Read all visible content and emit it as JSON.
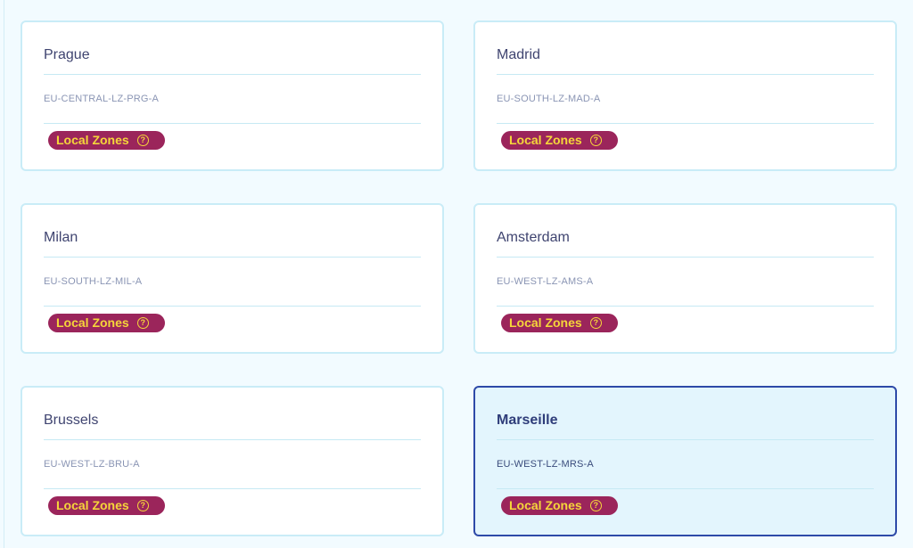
{
  "badge": {
    "label": "Local Zones",
    "icon": "question-circle-icon",
    "icon_glyph": "?",
    "bg_color": "#9b255b",
    "text_color": "#f5d63a"
  },
  "colors": {
    "selected_border": "#2e4aa8",
    "selected_bg": "#e3f5fd",
    "card_border": "#c9ecf7"
  },
  "zones": [
    {
      "name": "Prague",
      "code": "EU-CENTRAL-LZ-PRG-A",
      "selected": false
    },
    {
      "name": "Madrid",
      "code": "EU-SOUTH-LZ-MAD-A",
      "selected": false
    },
    {
      "name": "Milan",
      "code": "EU-SOUTH-LZ-MIL-A",
      "selected": false
    },
    {
      "name": "Amsterdam",
      "code": "EU-WEST-LZ-AMS-A",
      "selected": false
    },
    {
      "name": "Brussels",
      "code": "EU-WEST-LZ-BRU-A",
      "selected": false
    },
    {
      "name": "Marseille",
      "code": "EU-WEST-LZ-MRS-A",
      "selected": true
    }
  ]
}
